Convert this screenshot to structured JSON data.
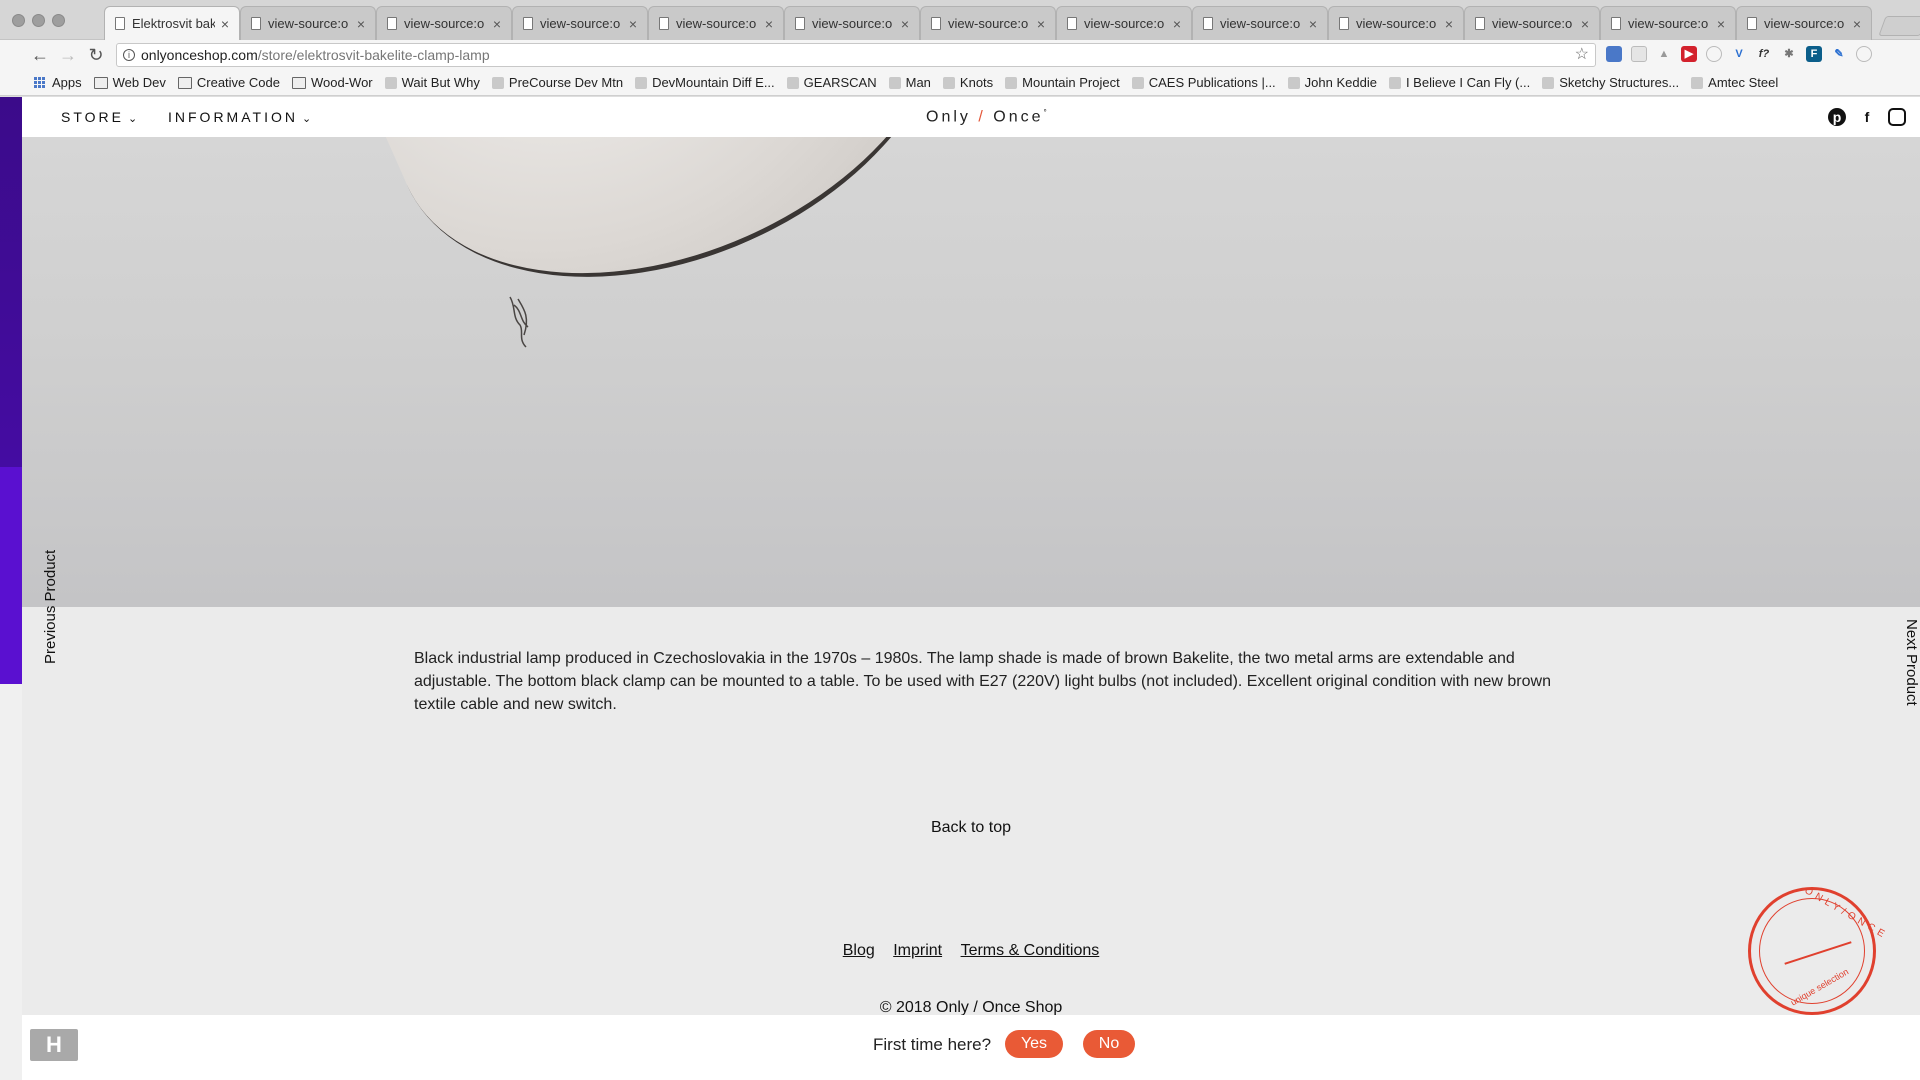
{
  "browser": {
    "tabs": [
      {
        "title": "Elektrosvit bak",
        "active": true
      },
      {
        "title": "view-source:o",
        "active": false
      },
      {
        "title": "view-source:o",
        "active": false
      },
      {
        "title": "view-source:o",
        "active": false
      },
      {
        "title": "view-source:o",
        "active": false
      },
      {
        "title": "view-source:o",
        "active": false
      },
      {
        "title": "view-source:o",
        "active": false
      },
      {
        "title": "view-source:o",
        "active": false
      },
      {
        "title": "view-source:o",
        "active": false
      },
      {
        "title": "view-source:o",
        "active": false
      },
      {
        "title": "view-source:o",
        "active": false
      },
      {
        "title": "view-source:o",
        "active": false
      },
      {
        "title": "view-source:o",
        "active": false
      }
    ],
    "url_host": "onlyonceshop.com",
    "url_path": "/store/elektrosvit-bakelite-clamp-lamp",
    "bookmarks": [
      {
        "label": "Apps",
        "icon": "apps-grid-icon"
      },
      {
        "label": "Web Dev",
        "icon": "folder-icon"
      },
      {
        "label": "Creative Code",
        "icon": "folder-icon"
      },
      {
        "label": "Wood-Wor",
        "icon": "folder-icon"
      },
      {
        "label": "Wait But Why",
        "icon": "site-icon"
      },
      {
        "label": "PreCourse Dev Mtn",
        "icon": "site-icon"
      },
      {
        "label": "DevMountain Diff E...",
        "icon": "site-icon"
      },
      {
        "label": "GEARSCAN",
        "icon": "site-icon"
      },
      {
        "label": "Man",
        "icon": "site-icon"
      },
      {
        "label": "Knots",
        "icon": "site-icon"
      },
      {
        "label": "Mountain Project",
        "icon": "site-icon"
      },
      {
        "label": "CAES Publications |...",
        "icon": "site-icon"
      },
      {
        "label": "John Keddie",
        "icon": "site-icon"
      },
      {
        "label": "I Believe I Can Fly (...",
        "icon": "site-icon"
      },
      {
        "label": "Sketchy Structures...",
        "icon": "site-icon"
      },
      {
        "label": "Amtec Steel",
        "icon": "site-icon"
      }
    ]
  },
  "site": {
    "nav": {
      "store": "STORE",
      "information": "INFORMATION"
    },
    "logo": {
      "left": "Only",
      "slash": "/",
      "right": "Once",
      "mark": "°"
    },
    "social": [
      "pinterest-icon",
      "facebook-icon",
      "instagram-icon"
    ],
    "previous_product": "Previous Product",
    "next_product": "Next Product",
    "description": "Black industrial lamp produced in Czechoslovakia in the 1970s – 1980s. The lamp shade is made of brown Bakelite, the two metal arms are extendable and adjustable. The bottom black clamp can be mounted to a table. To be used with E27 (220V) light bulbs (not included). Excellent original condition with new brown textile cable and new switch.",
    "back_to_top": "Back to top",
    "footer_links": {
      "blog": "Blog",
      "imprint": "Imprint",
      "terms": "Terms & Conditions"
    },
    "copyright": "© 2018 Only / Once Shop",
    "stamp": {
      "top": "ONLY/ONCE",
      "bottom": "unique selection"
    },
    "cookie": {
      "question": "First time here?",
      "yes": "Yes",
      "no": "No"
    }
  },
  "colors": {
    "accent": "#e95a36",
    "stamp": "#e0402e"
  }
}
